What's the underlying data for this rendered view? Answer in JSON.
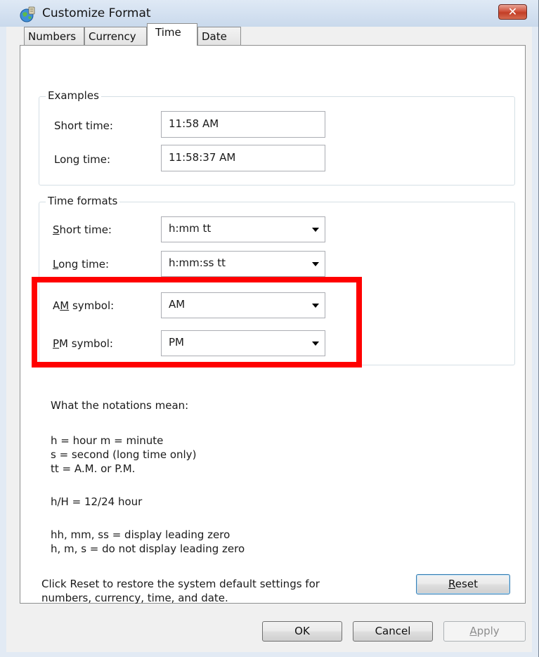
{
  "window": {
    "title": "Customize Format",
    "close_label": "✕"
  },
  "tabs": [
    {
      "label": "Numbers"
    },
    {
      "label": "Currency"
    },
    {
      "label": "Time"
    },
    {
      "label": "Date"
    }
  ],
  "examples": {
    "legend": "Examples",
    "short_label": "Short time:",
    "short_value": "11:58 AM",
    "long_label": "Long time:",
    "long_value": "11:58:37 AM"
  },
  "formats": {
    "legend": "Time formats",
    "short_label_key": "S",
    "short_label_rest": "hort time:",
    "short_value": "h:mm tt",
    "long_label_key": "L",
    "long_label_rest": "ong time:",
    "long_value": "h:mm:ss tt",
    "am_label_pre": "A",
    "am_label_key": "M",
    "am_label_rest": " symbol:",
    "am_value": "AM",
    "pm_label_key": "P",
    "pm_label_rest": "M symbol:",
    "pm_value": "PM"
  },
  "notes": {
    "heading": "What the notations mean:",
    "line1": "h = hour   m = minute",
    "line2": "s = second (long time only)",
    "line3": "tt = A.M. or P.M.",
    "line4": "h/H = 12/24 hour",
    "line5": "hh, mm, ss = display leading zero",
    "line6": "h, m, s = do not display leading zero"
  },
  "reset": {
    "text1": "Click Reset to restore the system default settings for",
    "text2": "numbers, currency, time, and date.",
    "button_key": "R",
    "button_rest": "eset"
  },
  "buttons": {
    "ok": "OK",
    "cancel": "Cancel",
    "apply_key": "A",
    "apply_rest": "pply"
  },
  "colors": {
    "highlight": "#ff0000",
    "titlebar": "#c9d9ec"
  },
  "icons": {
    "app": "globe-icon",
    "close": "close-icon",
    "dropdown": "chevron-down-icon"
  }
}
